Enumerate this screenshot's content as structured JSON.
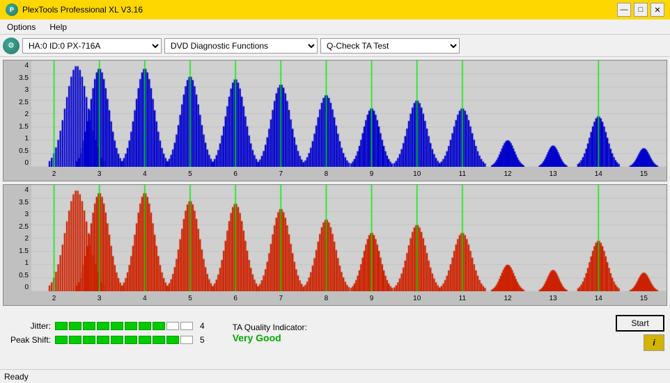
{
  "app": {
    "title": "PlexTools Professional XL V3.16",
    "icon": "P"
  },
  "titlebar": {
    "minimize": "—",
    "maximize": "□",
    "close": "✕"
  },
  "menu": {
    "items": [
      "Options",
      "Help"
    ]
  },
  "toolbar": {
    "drive": "HA:0 ID:0  PX-716A",
    "function": "DVD Diagnostic Functions",
    "test": "Q-Check TA Test"
  },
  "chart1": {
    "yLabels": [
      "4",
      "3.5",
      "3",
      "2.5",
      "2",
      "1.5",
      "1",
      "0.5",
      "0"
    ],
    "xLabels": [
      "2",
      "3",
      "4",
      "5",
      "6",
      "7",
      "8",
      "9",
      "10",
      "11",
      "12",
      "13",
      "14",
      "15"
    ],
    "color": "#0000ff"
  },
  "chart2": {
    "yLabels": [
      "4",
      "3.5",
      "3",
      "2.5",
      "2",
      "1.5",
      "1",
      "0.5",
      "0"
    ],
    "xLabels": [
      "2",
      "3",
      "4",
      "5",
      "6",
      "7",
      "8",
      "9",
      "10",
      "11",
      "12",
      "13",
      "14",
      "15"
    ],
    "color": "#cc0000"
  },
  "metrics": {
    "jitter_label": "Jitter:",
    "jitter_filled": 8,
    "jitter_total": 10,
    "jitter_value": "4",
    "peakshift_label": "Peak Shift:",
    "peakshift_filled": 9,
    "peakshift_total": 10,
    "peakshift_value": "5",
    "ta_label": "TA Quality Indicator:",
    "ta_value": "Very Good"
  },
  "buttons": {
    "start": "Start",
    "info": "i"
  },
  "statusbar": {
    "text": "Ready"
  }
}
